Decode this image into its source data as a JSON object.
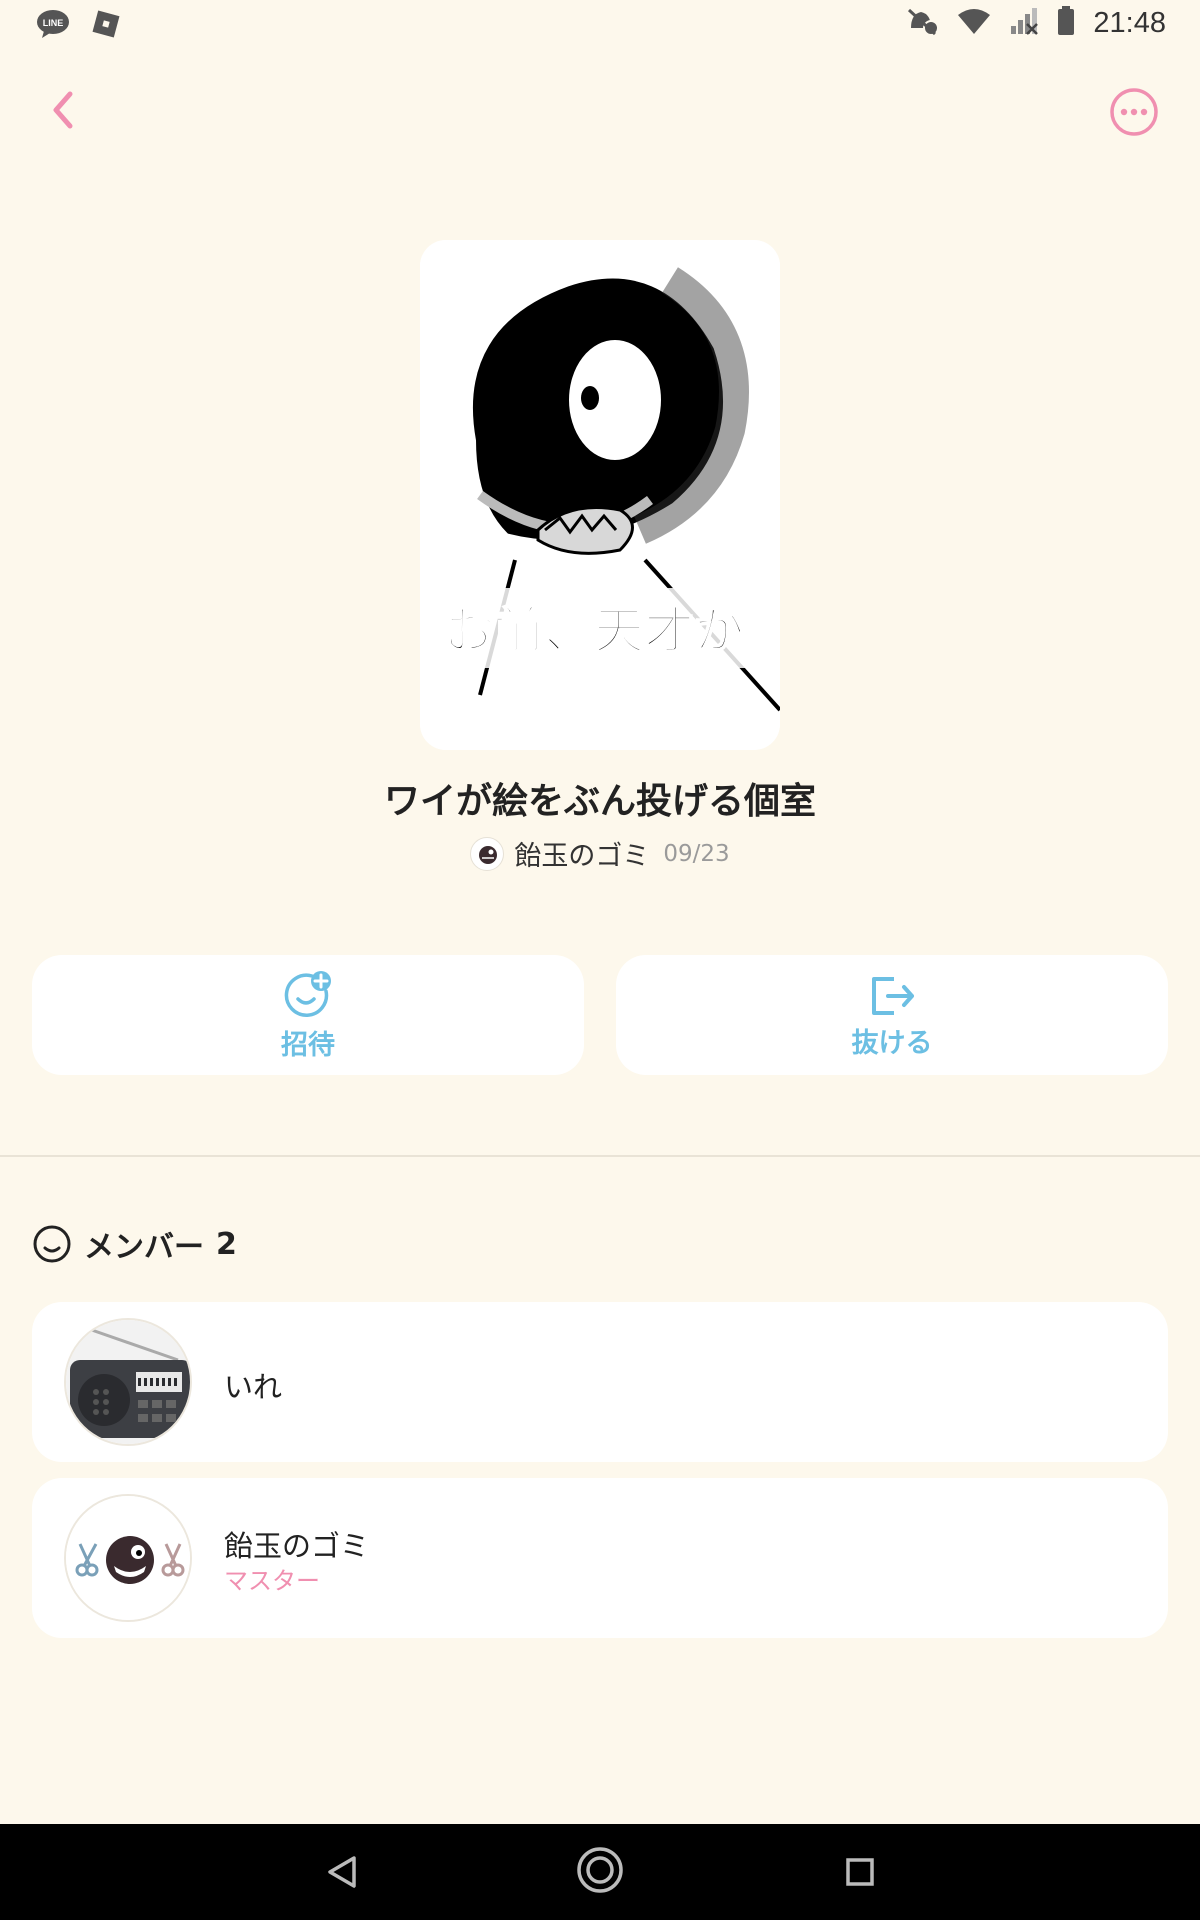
{
  "status_bar": {
    "time": "21:48",
    "icons": [
      "line-app-icon",
      "roblox-icon",
      "alarm-icon",
      "wifi-icon",
      "no-signal-icon",
      "battery-icon"
    ]
  },
  "header": {
    "back": "back-icon",
    "more": "more-icon"
  },
  "room": {
    "cover_caption": "お前、天才か",
    "title": "ワイが絵をぶん投げる個室",
    "owner_name": "飴玉のゴミ",
    "date": "09/23"
  },
  "actions": {
    "invite_label": "招待",
    "leave_label": "抜ける"
  },
  "members": {
    "header_label": "メンバー",
    "count": "2",
    "list": [
      {
        "name": "いれ",
        "role": ""
      },
      {
        "name": "飴玉のゴミ",
        "role": "マスター"
      }
    ]
  },
  "colors": {
    "background": "#fdf8ec",
    "accent_pink": "#f08fb0",
    "accent_blue": "#6cbfe3",
    "card": "#ffffff"
  }
}
